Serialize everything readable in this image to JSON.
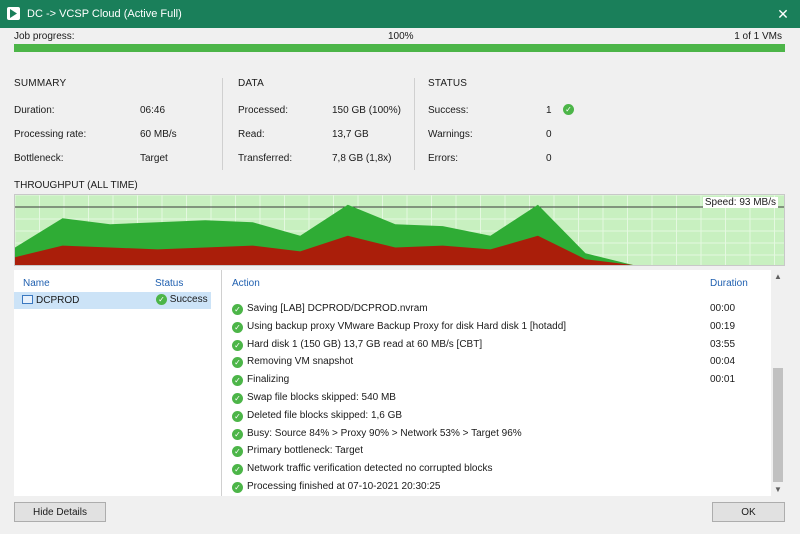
{
  "window": {
    "title": "DC -> VCSP Cloud (Active Full)",
    "close_glyph": "✕"
  },
  "job": {
    "label": "Job progress:",
    "percent_text": "100%",
    "vms_text": "1 of 1 VMs",
    "progress": 1.0
  },
  "summary": {
    "heading": "SUMMARY",
    "duration_label": "Duration:",
    "duration_value": "06:46",
    "rate_label": "Processing rate:",
    "rate_value": "60 MB/s",
    "bottleneck_label": "Bottleneck:",
    "bottleneck_value": "Target"
  },
  "data_section": {
    "heading": "DATA",
    "processed_label": "Processed:",
    "processed_value": "150 GB (100%)",
    "read_label": "Read:",
    "read_value": "13,7 GB",
    "transferred_label": "Transferred:",
    "transferred_value": "7,8 GB (1,8x)"
  },
  "status": {
    "heading": "STATUS",
    "success_label": "Success:",
    "success_value": "1",
    "warnings_label": "Warnings:",
    "warnings_value": "0",
    "errors_label": "Errors:",
    "errors_value": "0"
  },
  "throughput": {
    "heading": "THROUGHPUT (ALL TIME)",
    "speed_text": "Speed: 93 MB/s",
    "colors": {
      "processing": "#2fac35",
      "transferred": "#aa1e0a",
      "background": "#c8f0c0"
    }
  },
  "chart_data": {
    "type": "area",
    "title": "THROUGHPUT (ALL TIME)",
    "x": [
      0,
      1,
      2,
      3,
      4,
      5,
      6,
      7,
      8,
      9,
      10,
      11,
      12,
      13
    ],
    "series": [
      {
        "values": [
          18,
          48,
          42,
          44,
          46,
          44,
          30,
          62,
          42,
          40,
          30,
          62,
          12,
          0
        ]
      },
      {
        "values": [
          8,
          20,
          18,
          16,
          18,
          20,
          14,
          30,
          18,
          20,
          16,
          30,
          6,
          0
        ]
      }
    ],
    "ylim": [
      0,
      72
    ],
    "grid": true
  },
  "vm_list": {
    "headers": {
      "name": "Name",
      "status": "Status"
    },
    "rows": [
      {
        "name": "DCPROD",
        "status": "Success"
      }
    ]
  },
  "actions": {
    "headers": {
      "action": "Action",
      "duration": "Duration"
    },
    "rows": [
      {
        "text": "Saving [LAB] DCPROD/DCPROD.nvram",
        "duration": "00:00"
      },
      {
        "text": "Using backup proxy VMware Backup Proxy for disk Hard disk 1 [hotadd]",
        "duration": "00:19"
      },
      {
        "text": "Hard disk 1 (150 GB) 13,7 GB read at 60 MB/s [CBT]",
        "duration": "03:55"
      },
      {
        "text": "Removing VM snapshot",
        "duration": "00:04"
      },
      {
        "text": "Finalizing",
        "duration": "00:01"
      },
      {
        "text": "Swap file blocks skipped: 540 MB",
        "duration": ""
      },
      {
        "text": "Deleted file blocks skipped: 1,6 GB",
        "duration": ""
      },
      {
        "text": "Busy: Source 84% > Proxy 90% > Network 53% > Target 96%",
        "duration": ""
      },
      {
        "text": "Primary bottleneck: Target",
        "duration": ""
      },
      {
        "text": "Network traffic verification detected no corrupted blocks",
        "duration": ""
      },
      {
        "text": "Processing finished at 07-10-2021 20:30:25",
        "duration": ""
      }
    ]
  },
  "buttons": {
    "hide_details": "Hide Details",
    "ok": "OK"
  }
}
